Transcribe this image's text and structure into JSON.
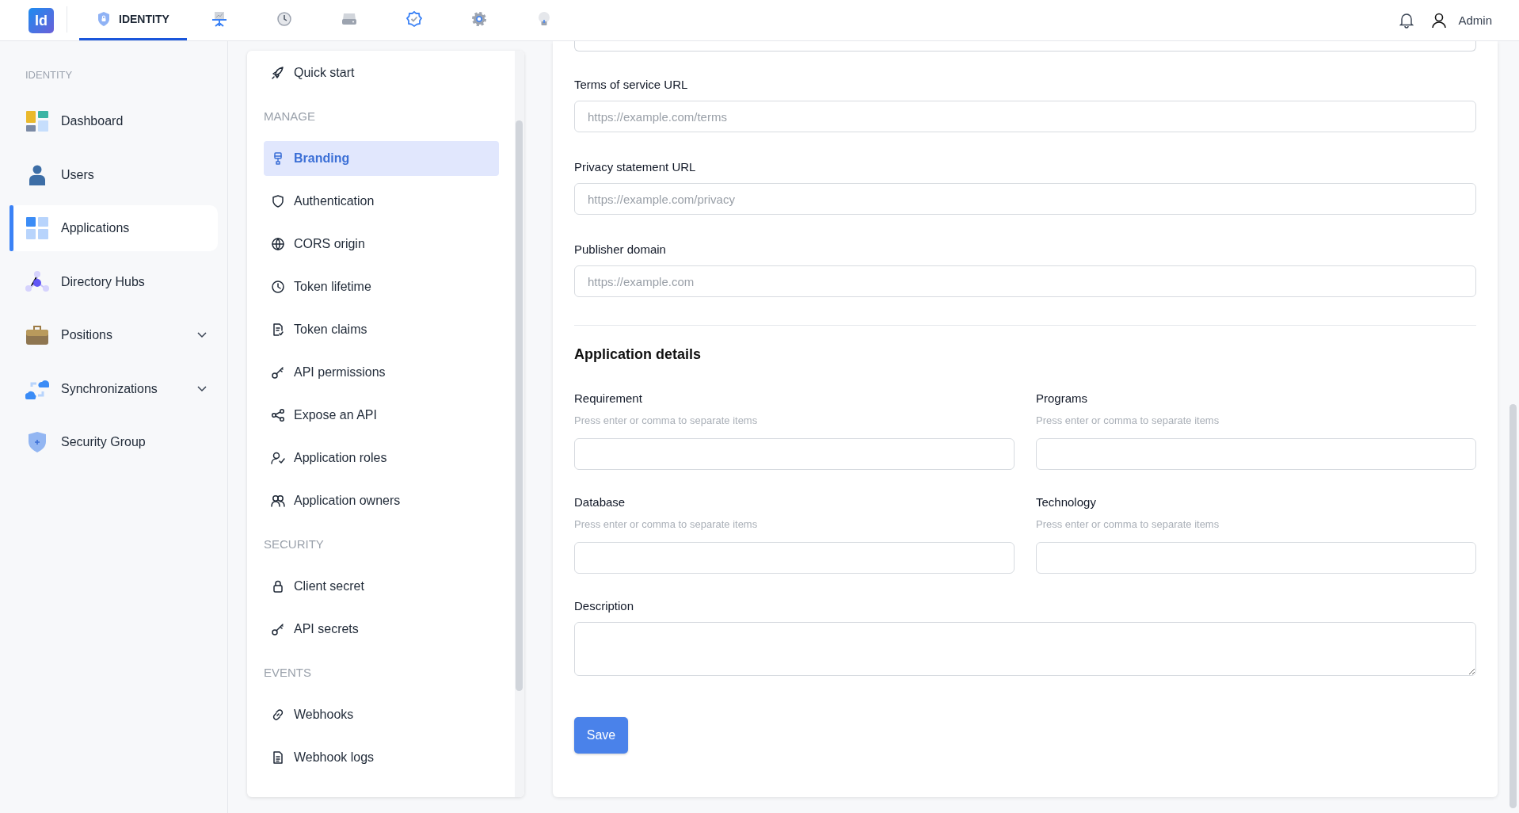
{
  "top_nav": {
    "logo": "Id",
    "tabs": [
      {
        "label": "IDENTITY",
        "selected": true
      },
      {
        "selected": false
      },
      {
        "selected": false
      },
      {
        "selected": false
      },
      {
        "selected": false
      },
      {
        "selected": false
      },
      {
        "selected": false
      }
    ],
    "user": "Admin"
  },
  "sidebar": {
    "title": "IDENTITY",
    "items": [
      {
        "label": "Dashboard",
        "selected": false,
        "expandable": false
      },
      {
        "label": "Users",
        "selected": false,
        "expandable": false
      },
      {
        "label": "Applications",
        "selected": true,
        "expandable": false
      },
      {
        "label": "Directory Hubs",
        "selected": false,
        "expandable": false
      },
      {
        "label": "Positions",
        "selected": false,
        "expandable": true
      },
      {
        "label": "Synchronizations",
        "selected": false,
        "expandable": true
      },
      {
        "label": "Security Group",
        "selected": false,
        "expandable": false
      }
    ]
  },
  "app_menu": {
    "items": [
      {
        "kind": "link",
        "label": "Quick start",
        "selected": false
      },
      {
        "kind": "section",
        "label": "MANAGE"
      },
      {
        "kind": "link",
        "label": "Branding",
        "selected": true
      },
      {
        "kind": "link",
        "label": "Authentication",
        "selected": false
      },
      {
        "kind": "link",
        "label": "CORS origin",
        "selected": false
      },
      {
        "kind": "link",
        "label": "Token lifetime",
        "selected": false
      },
      {
        "kind": "link",
        "label": "Token claims",
        "selected": false
      },
      {
        "kind": "link",
        "label": "API permissions",
        "selected": false
      },
      {
        "kind": "link",
        "label": "Expose an API",
        "selected": false
      },
      {
        "kind": "link",
        "label": "Application roles",
        "selected": false
      },
      {
        "kind": "link",
        "label": "Application owners",
        "selected": false
      },
      {
        "kind": "section",
        "label": "SECURITY"
      },
      {
        "kind": "link",
        "label": "Client secret",
        "selected": false
      },
      {
        "kind": "link",
        "label": "API secrets",
        "selected": false
      },
      {
        "kind": "section",
        "label": "EVENTS"
      },
      {
        "kind": "link",
        "label": "Webhooks",
        "selected": false
      },
      {
        "kind": "link",
        "label": "Webhook logs",
        "selected": false
      }
    ]
  },
  "form": {
    "url_fields": [
      {
        "label": "Terms of service URL",
        "placeholder": "https://example.com/terms"
      },
      {
        "label": "Privacy statement URL",
        "placeholder": "https://example.com/privacy"
      },
      {
        "label": "Publisher domain",
        "placeholder": "https://example.com"
      }
    ],
    "section_title": "Application details",
    "tag_fields": [
      {
        "label": "Requirement",
        "hint": "Press enter or comma to separate items"
      },
      {
        "label": "Programs",
        "hint": "Press enter or comma to separate items"
      },
      {
        "label": "Database",
        "hint": "Press enter or comma to separate items"
      },
      {
        "label": "Technology",
        "hint": "Press enter or comma to separate items"
      }
    ],
    "description": {
      "label": "Description"
    },
    "save_button": "Save"
  }
}
